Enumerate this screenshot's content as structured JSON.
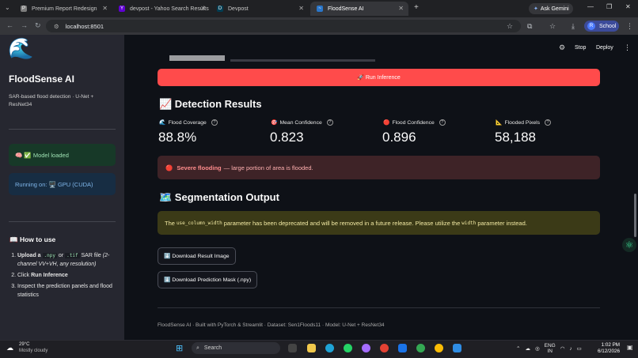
{
  "browser": {
    "tabs": [
      {
        "label": "Premium Report Redesign",
        "fav": "P"
      },
      {
        "label": "devpost - Yahoo Search Results",
        "fav": "Y"
      },
      {
        "label": "Devpost",
        "fav": "D"
      },
      {
        "label": "FloodSense AI",
        "fav": "~"
      }
    ],
    "ask_gemini": "Ask Gemini",
    "url": "localhost:8501",
    "profile": "School",
    "profile_initial": "R"
  },
  "sidebar": {
    "logo": "🌊",
    "app_name": "FloodSense AI",
    "description": "SAR-based flood detection · U-Net + ResNet34",
    "model_status": "🧠 ✅ Model loaded",
    "running_on": "Running on: 🖥️ GPU (CUDA)",
    "how_to_title": "📖 How to use",
    "steps": {
      "s1_a": "Upload a",
      "s1_code1": ".npy",
      "s1_or": "or",
      "s1_code2": ".tif",
      "s1_b": "SAR file",
      "s1_c": "(2-channel VV+VH, any resolution)",
      "s2_a": "Click",
      "s2_b": "Run Inference",
      "s3": "Inspect the prediction panels and flood statistics"
    }
  },
  "topbar": {
    "stop": "Stop",
    "deploy": "Deploy"
  },
  "main": {
    "run_button": "🚀 Run Inference",
    "detection_title": "📈 Detection Results",
    "metrics": [
      {
        "icon": "🌊",
        "label": "Flood Coverage",
        "value": "88.8%"
      },
      {
        "icon": "🎯",
        "label": "Mean Confidence",
        "value": "0.823"
      },
      {
        "icon": "🔴",
        "label": "Flood Confidence",
        "value": "0.896"
      },
      {
        "icon": "📐",
        "label": "Flooded Pixels",
        "value": "58,188"
      }
    ],
    "alert": {
      "icon": "🔴",
      "bold": "Severe flooding",
      "text": "— large portion of area is flooded."
    },
    "segmentation_title": "🗺️ Segmentation Output",
    "warning": {
      "pre": "The",
      "code1": "use_column_width",
      "mid": "parameter has been deprecated and will be removed in a future release. Please utilize the",
      "code2": "width",
      "post": "parameter instead."
    },
    "download_image": "⬇️ Download Result Image",
    "download_mask": "⬇️ Download Prediction Mask (.npy)",
    "footer": "FloodSense AI · Built with PyTorch & Streamlit · Dataset: Sen1Floods11 · Model: U-Net + ResNet34"
  },
  "taskbar": {
    "temperature": "29°C",
    "weather": "Mostly cloudy",
    "search": "Search",
    "lang1": "ENG",
    "lang2": "IN",
    "time": "1:02 PM",
    "date": "6/12/2026"
  },
  "colors": {
    "primary": "#ff4b4b",
    "sidebar_bg": "#262730",
    "main_bg": "#0e1117",
    "success_bg": "#173928",
    "info_bg": "#172d43",
    "error_bg": "#3e2327",
    "warning_bg": "#3b3a17"
  }
}
